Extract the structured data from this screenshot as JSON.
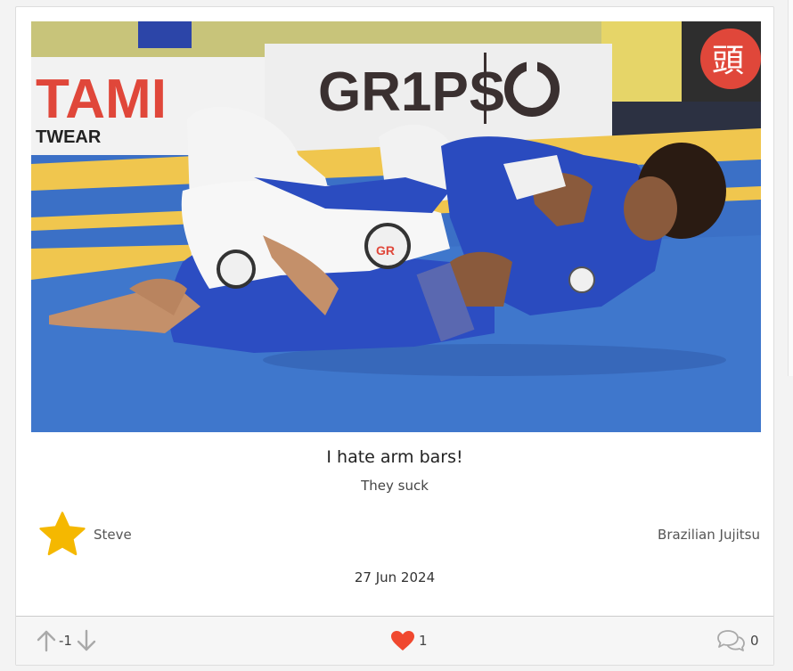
{
  "post": {
    "title": "I hate arm bars!",
    "body": "They suck",
    "author": "Steve",
    "category": "Brazilian Jujitsu",
    "date": "27 Jun 2024"
  },
  "image": {
    "banner_left": "TAMI",
    "banner_left_sub": "TWEAR",
    "banner_center": "GR1PS",
    "banner_right": "頭"
  },
  "footer": {
    "score": "-1",
    "likes": "1",
    "comments": "0"
  },
  "colors": {
    "star": "#f5b800",
    "heart": "#f0482f",
    "mat_blue": "#3a6fc4",
    "mat_yellow": "#f0c64e"
  },
  "icons": {
    "upvote": "arrow-up-icon",
    "downvote": "arrow-down-icon",
    "like": "heart-icon",
    "comments": "chat-bubbles-icon",
    "author_badge": "star-icon"
  }
}
